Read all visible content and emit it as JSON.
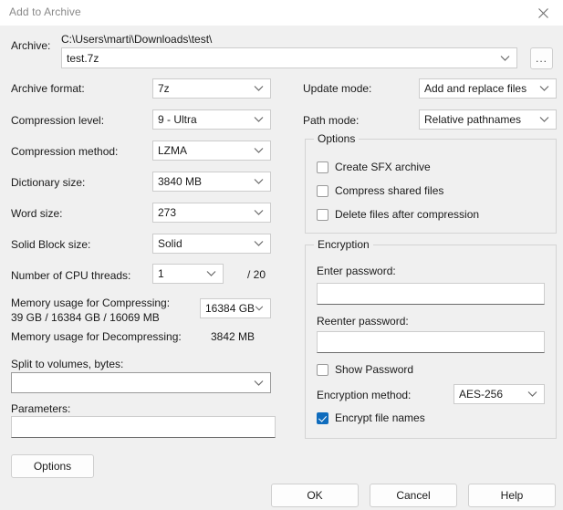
{
  "window": {
    "title": "Add to Archive",
    "close_icon": "close-icon"
  },
  "archive": {
    "label": "Archive:",
    "path": "C:\\Users\\marti\\Downloads\\test\\",
    "filename": "test.7z",
    "browse_label": "..."
  },
  "left": {
    "archive_format": {
      "label": "Archive format:",
      "value": "7z"
    },
    "compression_level": {
      "label": "Compression level:",
      "value": "9 - Ultra"
    },
    "compression_method": {
      "label": "Compression method:",
      "value": "LZMA"
    },
    "dictionary_size": {
      "label": "Dictionary size:",
      "value": "3840 MB"
    },
    "word_size": {
      "label": "Word size:",
      "value": "273"
    },
    "solid_block_size": {
      "label": "Solid Block size:",
      "value": "Solid"
    },
    "cpu_threads": {
      "label": "Number of CPU threads:",
      "value": "1",
      "total": "/ 20"
    },
    "memory_compressing": {
      "label": "Memory usage for Compressing:",
      "values": "39 GB / 16384 GB / 16069 MB",
      "dropdown": "16384 GB"
    },
    "memory_decompressing": {
      "label": "Memory usage for Decompressing:",
      "value": "3842 MB"
    },
    "split_volumes": {
      "label": "Split to volumes, bytes:",
      "value": ""
    },
    "parameters": {
      "label": "Parameters:",
      "value": ""
    }
  },
  "right": {
    "update_mode": {
      "label": "Update mode:",
      "value": "Add and replace files"
    },
    "path_mode": {
      "label": "Path mode:",
      "value": "Relative pathnames"
    },
    "options_group": {
      "title": "Options",
      "items": [
        {
          "label": "Create SFX archive",
          "checked": false
        },
        {
          "label": "Compress shared files",
          "checked": false
        },
        {
          "label": "Delete files after compression",
          "checked": false
        }
      ]
    },
    "encryption_group": {
      "title": "Encryption",
      "enter_password_label": "Enter password:",
      "enter_password_value": "",
      "reenter_password_label": "Reenter password:",
      "reenter_password_value": "",
      "show_password": {
        "label": "Show Password",
        "checked": false
      },
      "encryption_method": {
        "label": "Encryption method:",
        "value": "AES-256"
      },
      "encrypt_file_names": {
        "label": "Encrypt file names",
        "checked": true
      }
    }
  },
  "footer": {
    "options_button": "Options",
    "ok_button": "OK",
    "cancel_button": "Cancel",
    "help_button": "Help"
  },
  "colors": {
    "accent": "#0f6cbd",
    "dialog_bg": "#f0f0f0",
    "field_bg": "#ffffff"
  }
}
